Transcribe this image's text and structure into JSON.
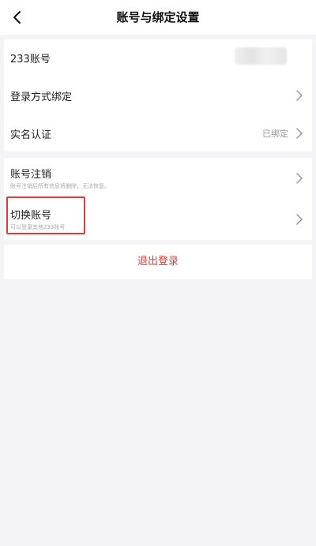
{
  "header": {
    "title": "账号与绑定设置",
    "back_icon": "chevron-left-icon"
  },
  "group_account": {
    "rows": [
      {
        "label": "233账号",
        "value": ""
      },
      {
        "label": "登录方式绑定",
        "value": ""
      },
      {
        "label": "实名认证",
        "value": "已绑定"
      }
    ]
  },
  "group_manage": {
    "rows": [
      {
        "title": "账号注销",
        "subtitle": "账号注销后所有信息将删除，无法恢复。"
      },
      {
        "title": "切换账号",
        "subtitle": "可以登录其他233账号"
      }
    ]
  },
  "logout": {
    "label": "退出登录",
    "color": "#e53935"
  },
  "colors": {
    "highlight_border": "#e23b3b",
    "background": "#f4f4f6",
    "card": "#ffffff"
  }
}
